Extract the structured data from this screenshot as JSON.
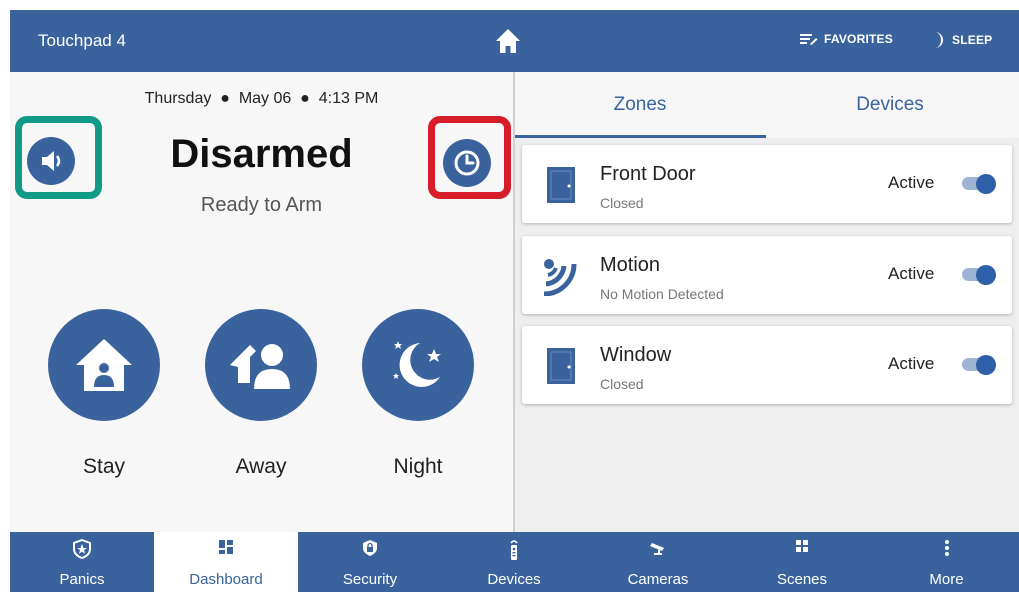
{
  "header": {
    "title": "Touchpad 4",
    "home_icon": "home-icon",
    "favorites_label": "FAVORITES",
    "sleep_label": "SLEEP"
  },
  "panel": {
    "day": "Thursday",
    "date": "May 06",
    "time": "4:13 PM",
    "status": "Disarmed",
    "substatus": "Ready to Arm",
    "arm_buttons": [
      {
        "label": "Stay",
        "icon": "stay-home-icon"
      },
      {
        "label": "Away",
        "icon": "away-people-icon"
      },
      {
        "label": "Night",
        "icon": "night-moon-icon"
      }
    ]
  },
  "tabs": [
    {
      "label": "Zones",
      "active": true
    },
    {
      "label": "Devices",
      "active": false
    }
  ],
  "zones": [
    {
      "name": "Front Door",
      "status": "Closed",
      "state": "Active",
      "icon": "door-icon",
      "toggle_on": true
    },
    {
      "name": "Motion",
      "status": "No Motion Detected",
      "state": "Active",
      "icon": "motion-sensor-icon",
      "toggle_on": true
    },
    {
      "name": "Window",
      "status": "Closed",
      "state": "Active",
      "icon": "window-icon",
      "toggle_on": true
    }
  ],
  "nav": [
    {
      "label": "Panics",
      "icon": "shield-star-icon"
    },
    {
      "label": "Dashboard",
      "icon": "dashboard-icon",
      "active": true
    },
    {
      "label": "Security",
      "icon": "security-shield-icon"
    },
    {
      "label": "Devices",
      "icon": "remote-icon"
    },
    {
      "label": "Cameras",
      "icon": "camera-icon"
    },
    {
      "label": "Scenes",
      "icon": "scenes-icon"
    },
    {
      "label": "More",
      "icon": "more-vertical-icon"
    }
  ],
  "colors": {
    "brand": "#3a639e",
    "highlight_green": "#129a88",
    "highlight_red": "#d71d27"
  }
}
